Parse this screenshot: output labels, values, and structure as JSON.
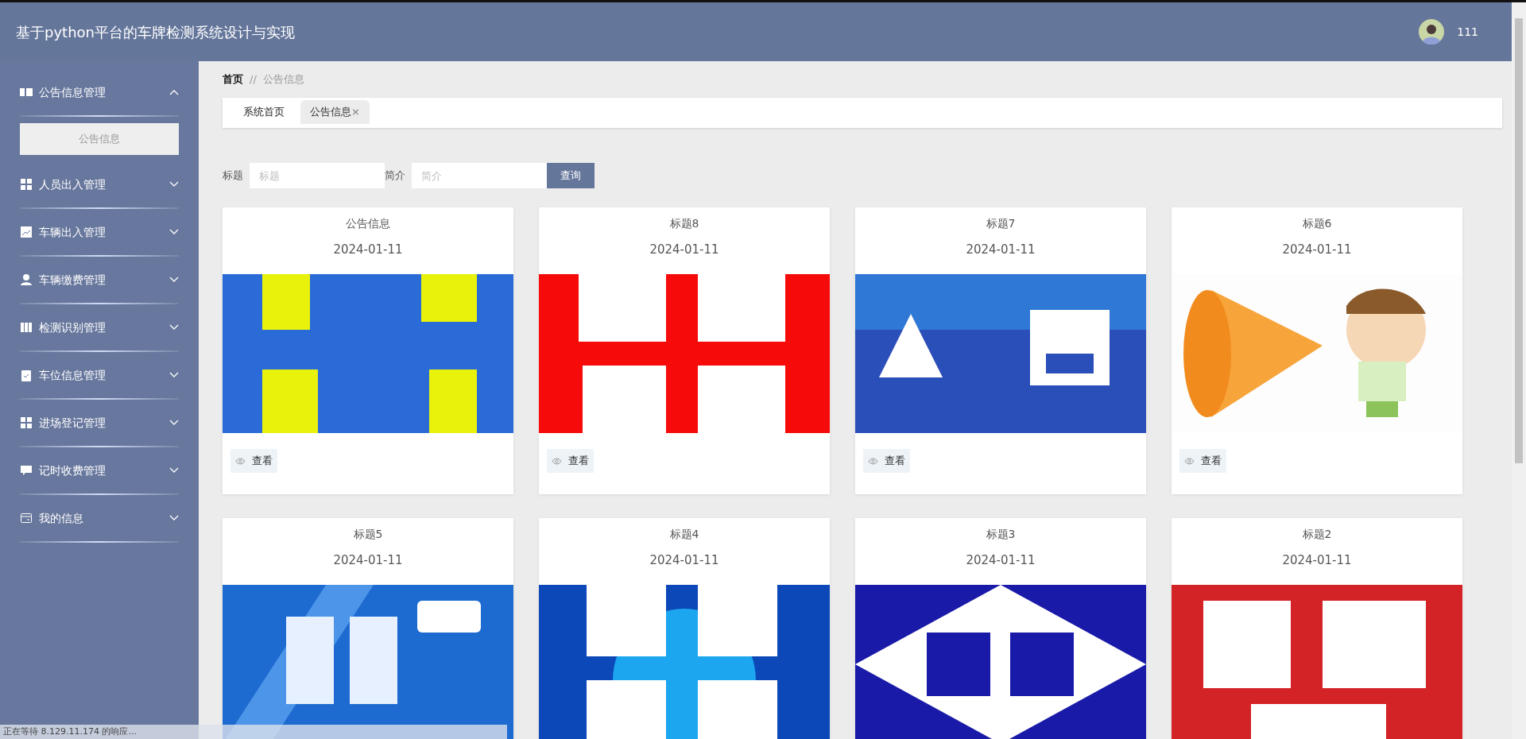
{
  "header": {
    "title": "基于python平台的车牌检测系统设计与实现",
    "user": "111"
  },
  "sidebar": {
    "items": [
      {
        "label": "公告信息管理",
        "expanded": true,
        "children": [
          {
            "label": "公告信息",
            "selected": true
          }
        ]
      },
      {
        "label": "人员出入管理",
        "expanded": false
      },
      {
        "label": "车辆出入管理",
        "expanded": false
      },
      {
        "label": "车辆缴费管理",
        "expanded": false
      },
      {
        "label": "检测识别管理",
        "expanded": false
      },
      {
        "label": "车位信息管理",
        "expanded": false
      },
      {
        "label": "进场登记管理",
        "expanded": false
      },
      {
        "label": "记时收费管理",
        "expanded": false
      },
      {
        "label": "我的信息",
        "expanded": false
      }
    ]
  },
  "breadcrumb": [
    "首页",
    "//",
    "公告信息"
  ],
  "tabs": [
    {
      "label": "系统首页",
      "selected": false
    },
    {
      "label": "公告信息",
      "selected": true,
      "close": "×"
    }
  ],
  "search": {
    "fields": [
      {
        "label": "标题",
        "placeholder": "标题"
      },
      {
        "label": "简介",
        "placeholder": "简介"
      }
    ],
    "button": "查询"
  },
  "cards": [
    {
      "title": "公告信息",
      "date": "2024-01-11",
      "action": "查看"
    },
    {
      "title": "标题8",
      "date": "2024-01-11",
      "action": "查看"
    },
    {
      "title": "标题7",
      "date": "2024-01-11",
      "action": "查看"
    },
    {
      "title": "标题6",
      "date": "2024-01-11",
      "action": "查看"
    },
    {
      "title": "标题5",
      "date": "2024-01-11"
    },
    {
      "title": "标题4",
      "date": "2024-01-11"
    },
    {
      "title": "标题3",
      "date": "2024-01-11"
    },
    {
      "title": "标题2",
      "date": "2024-01-11"
    }
  ],
  "status_bar": "正在等待 8.129.11.174 的响应..."
}
